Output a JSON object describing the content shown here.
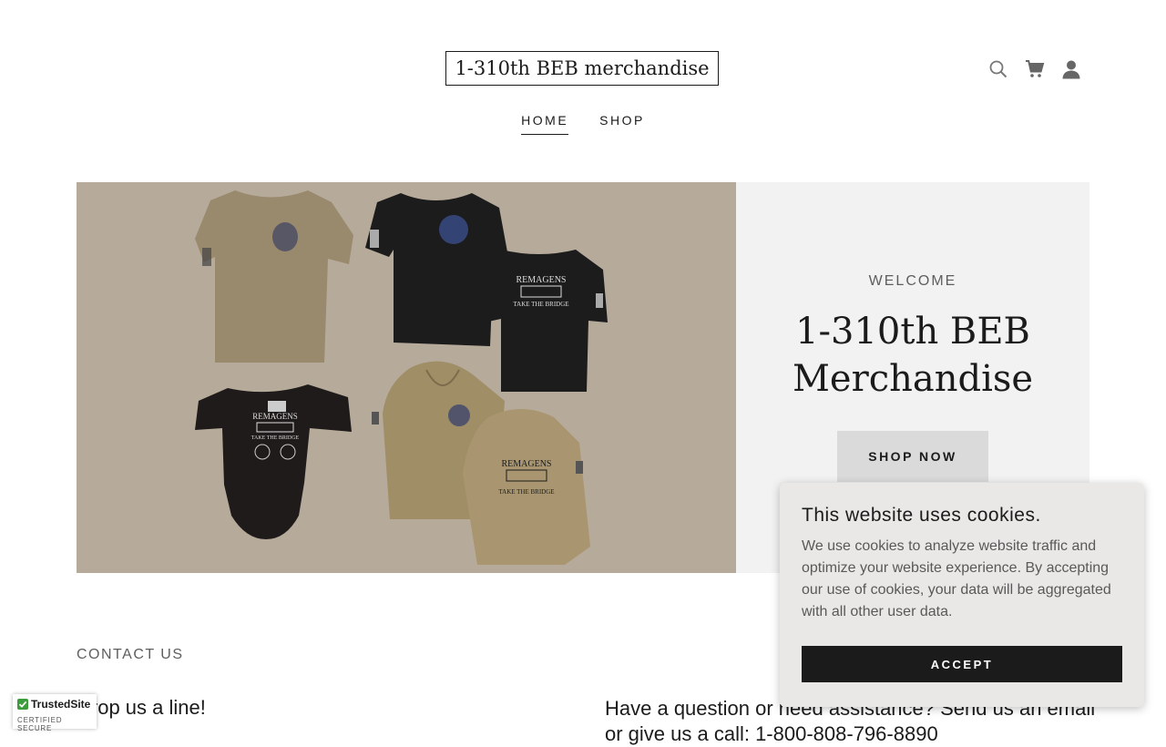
{
  "header": {
    "logo_text": "1-310th BEB merchandise",
    "icons": [
      "search-icon",
      "cart-icon",
      "account-icon"
    ]
  },
  "nav": {
    "items": [
      {
        "label": "HOME",
        "active": true
      },
      {
        "label": "SHOP",
        "active": false
      }
    ]
  },
  "hero": {
    "eyebrow": "WELCOME",
    "title_line1": "1-310th BEB",
    "title_line2": "Merchandise",
    "button_label": "SHOP NOW",
    "image_alt": "Unit apparel: t-shirts, baby onesie and hoodies",
    "shirt_prints": [
      "REMAGENS",
      "TAKE THE BRIDGE"
    ],
    "image_bg": "#b6aa9a",
    "panel_bg": "#f2f2f2"
  },
  "contact": {
    "label": "CONTACT US",
    "left_text": "Drop us a line!",
    "right_text": "Have a question or need assistance? Send us an email or give us a call: 1-800-808-796-8890"
  },
  "cookie_banner": {
    "title": "This website uses cookies.",
    "body": "We use cookies to analyze website traffic and optimize your website experience. By accepting our use of cookies, your data will be aggregated with all other user data.",
    "accept_label": "ACCEPT"
  },
  "badge": {
    "title": "TrustedSite",
    "subtitle": "CERTIFIED SECURE"
  }
}
